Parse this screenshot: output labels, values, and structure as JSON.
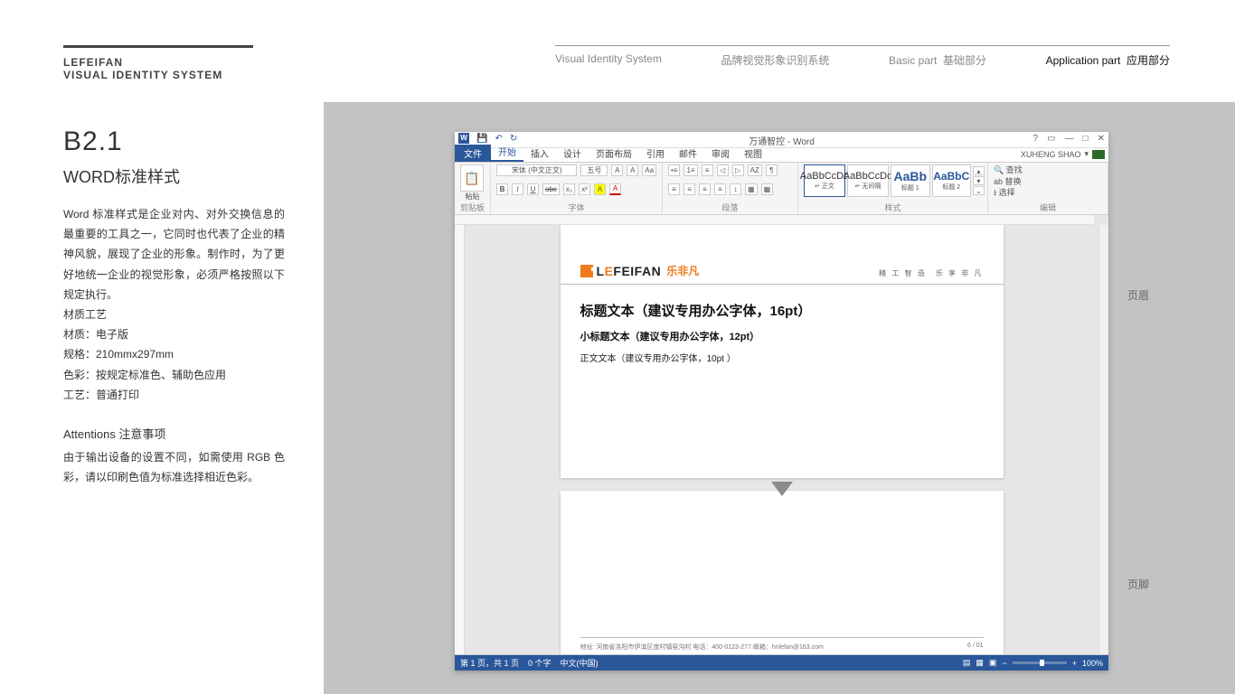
{
  "brand": {
    "line1": "LEFEIFAN",
    "line2": "VISUAL IDENTITY SYSTEM"
  },
  "nav": {
    "item1": "Visual Identity System",
    "item2": "品牌视觉形象识别系统",
    "item3a": "Basic part",
    "item3b": "基础部分",
    "item4a": "Application part",
    "item4b": "应用部分"
  },
  "left": {
    "code": "B2.1",
    "title": "WORD标准样式",
    "body": "Word 标准样式是企业对内、对外交换信息的最重要的工具之一，它同时也代表了企业的精神风貌，展现了企业的形象。制作时，为了更好地统一企业的视觉形象，必须严格按照以下规定执行。",
    "mat_heading": "材质工艺",
    "mat1": "材质：电子版",
    "mat2": "规格：210mmx297mm",
    "mat3": "色彩：按规定标准色、辅助色应用",
    "mat4": "工艺：普通打印",
    "att_heading": "Attentions 注意事项",
    "att_body": "由于输出设备的设置不同，如需使用 RGB 色彩，请以印刷色值为标准选择相近色彩。"
  },
  "annotations": {
    "header": "页眉",
    "footer": "页脚"
  },
  "word": {
    "title": "万通智控 - Word",
    "user": "XUHENG SHAO",
    "controls": {
      "help": "?",
      "collapse": "▭",
      "min": "—",
      "max": "□",
      "close": "✕"
    },
    "qat": {
      "save": "💾",
      "undo": "↶",
      "redo": "↻"
    },
    "tabs": {
      "file": "文件",
      "home": "开始",
      "insert": "插入",
      "design": "设计",
      "layout": "页面布局",
      "ref": "引用",
      "mail": "邮件",
      "review": "审阅",
      "view": "视图"
    },
    "ribbon": {
      "clipboard": {
        "label": "剪贴板",
        "paste": "粘贴"
      },
      "font": {
        "label": "字体",
        "name": "宋体 (中文正文)",
        "size": "五号",
        "bold": "B",
        "italic": "I",
        "underline": "U",
        "strike": "abc",
        "sub": "x₂",
        "sup": "x²",
        "hl": "A",
        "color": "A",
        "aa": "Aa",
        "clear": "A̷"
      },
      "para": {
        "label": "段落"
      },
      "styles": {
        "label": "样式",
        "s1p": "AaBbCcDd",
        "s1l": "↵ 正文",
        "s2p": "AaBbCcDd",
        "s2l": "↵ 无间隔",
        "s3p": "AaBb",
        "s3l": "标题 1",
        "s4p": "AaBbC",
        "s4l": "标题 2"
      },
      "edit": {
        "label": "编辑",
        "find": "查找",
        "replace": "替换",
        "select": "选择"
      }
    },
    "doc": {
      "logo_text_a": "L",
      "logo_text_b": "E",
      "logo_text_c": "FEIFAN",
      "logo_cn": "乐非凡",
      "slogan": "精 工 智 造　乐 享 非 凡",
      "h1": "标题文本（建议专用办公字体，16pt）",
      "h2": "小标题文本（建议专用办公字体，12pt）",
      "p": "正文文本（建议专用办公字体，10pt ）",
      "footer_left": "地址: 河南省洛阳市伊滨区庞村镇窑沟村   电话：400-0123-277   邮箱：hnlefan@163.com",
      "footer_right": "6 / 01"
    },
    "status": {
      "page": "第 1 页，共 1 页",
      "words": "0 个字",
      "lang": "中文(中国)",
      "zoom": "100%",
      "plus": "+",
      "minus": "−"
    }
  }
}
